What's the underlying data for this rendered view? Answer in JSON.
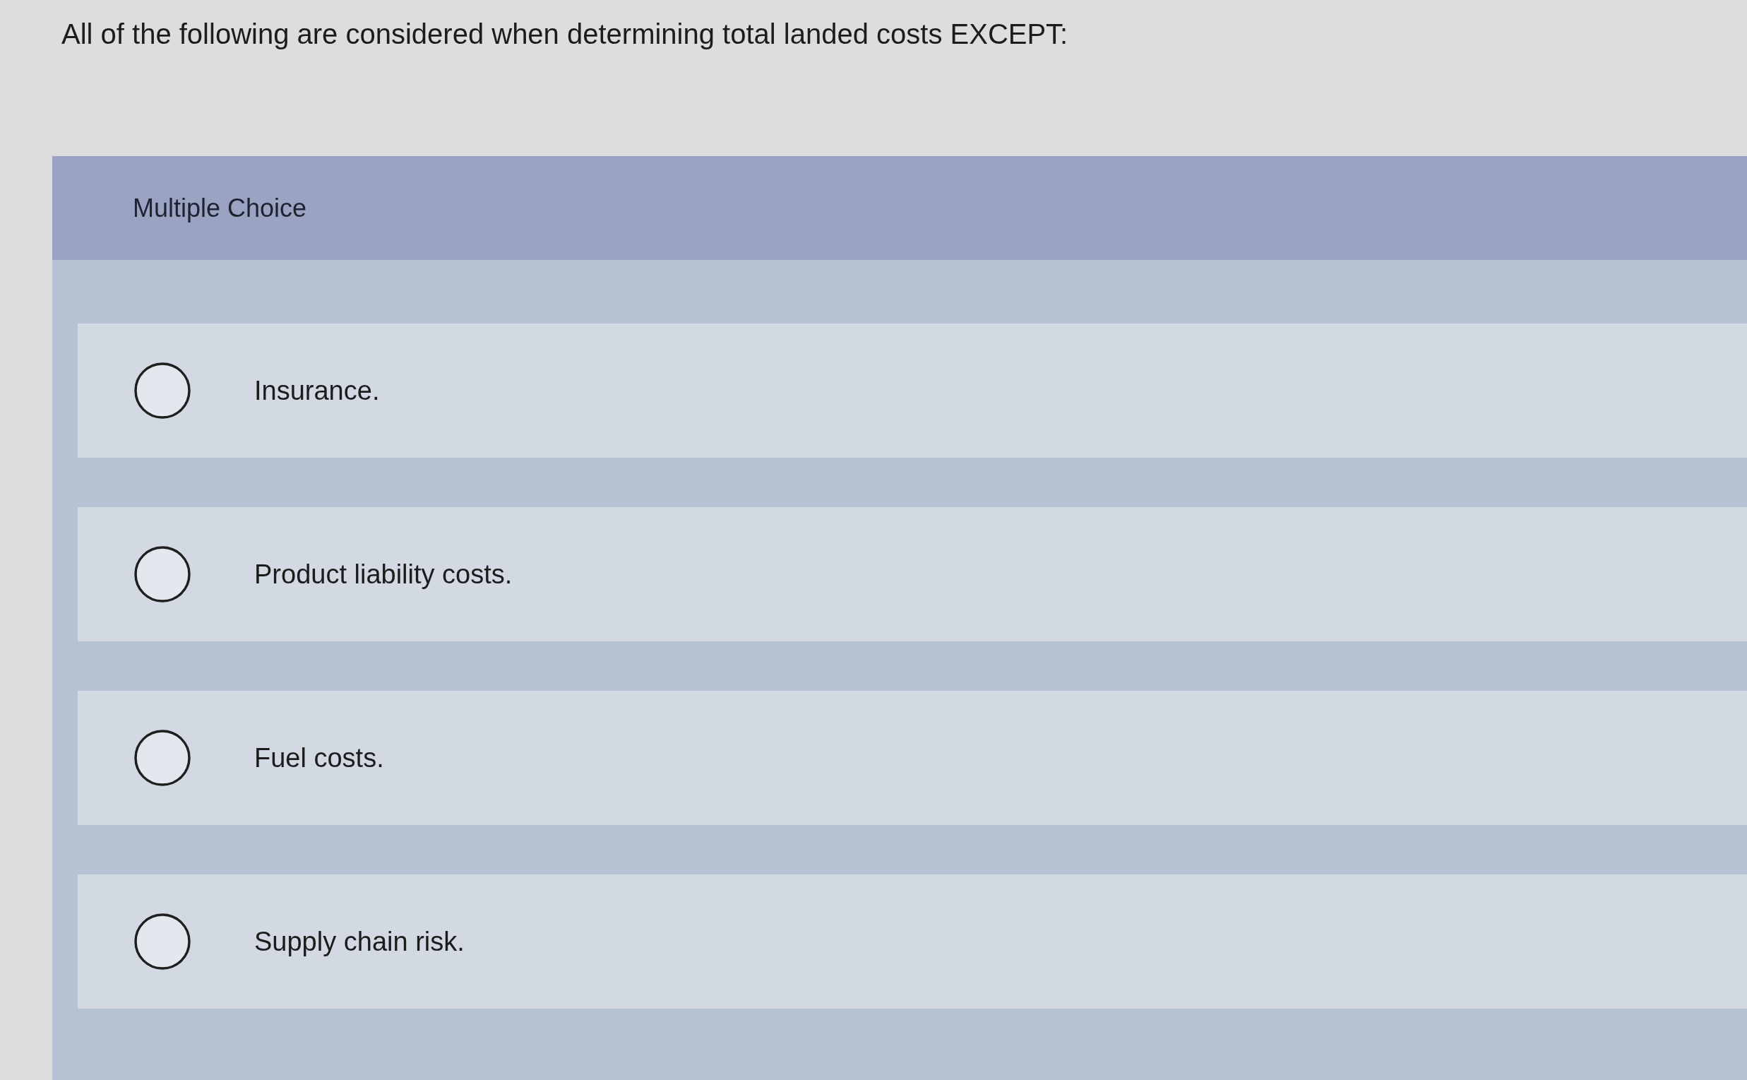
{
  "question": "All of the following are considered when determining total landed costs EXCEPT:",
  "answer_panel": {
    "heading": "Multiple Choice",
    "options": [
      {
        "label": "Insurance.",
        "selected": false
      },
      {
        "label": "Product liability costs.",
        "selected": false
      },
      {
        "label": "Fuel costs.",
        "selected": false
      },
      {
        "label": "Supply chain risk.",
        "selected": false
      }
    ]
  }
}
